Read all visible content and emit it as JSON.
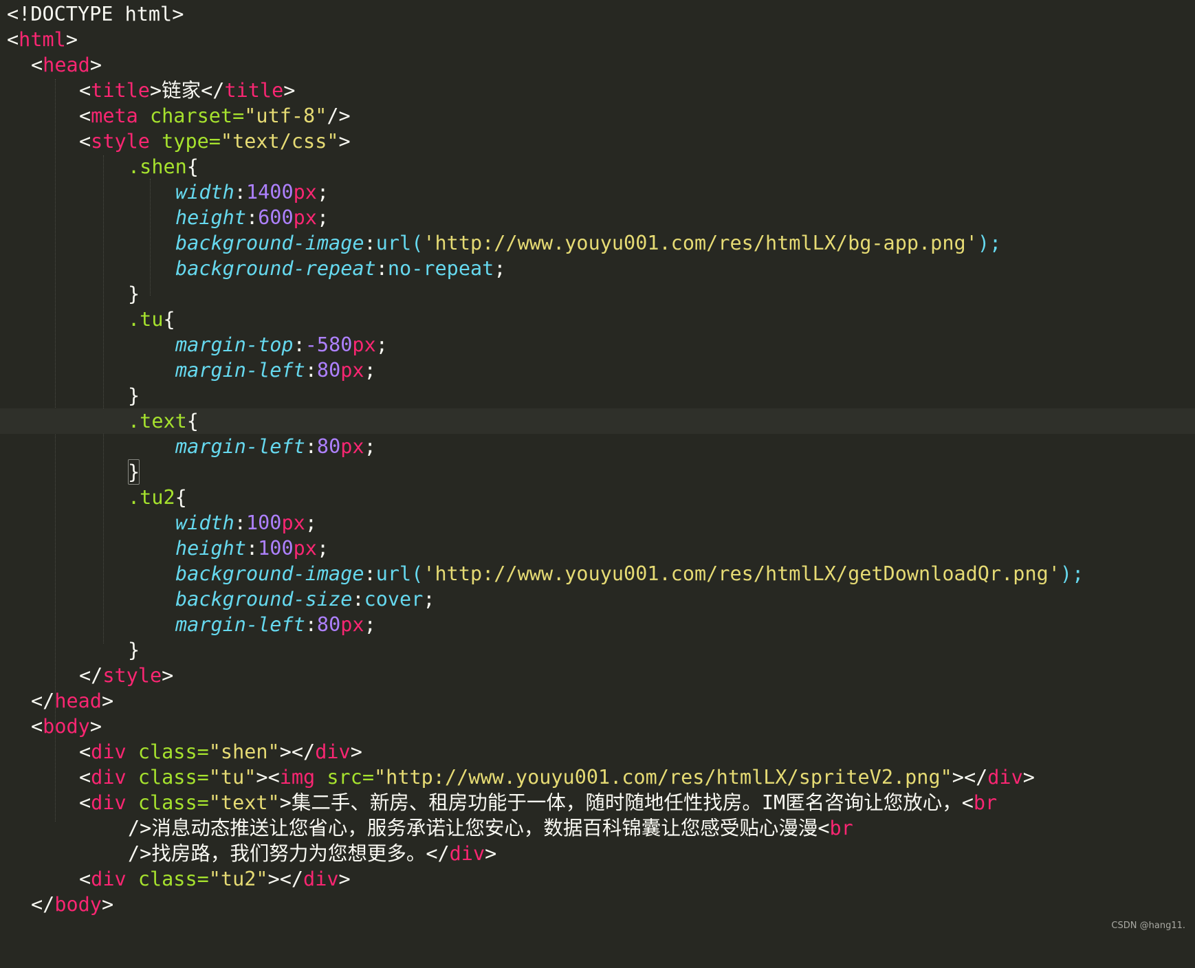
{
  "editor": {
    "theme": "monokai",
    "colors": {
      "background": "#272822",
      "tag": "#f92672",
      "attribute": "#a6e22e",
      "string": "#e6db74",
      "property": "#66d9ef",
      "number": "#ae81ff",
      "text": "#f8f8f2"
    },
    "lines": {
      "l1": "<!DOCTYPE html>",
      "l2_open": "<",
      "l2_tag": "html",
      "l2_close": ">",
      "l3_open": "<",
      "l3_tag": "head",
      "l3_close": ">",
      "l4_open": "<",
      "l4_tag": "title",
      "l4_mid": ">链家</",
      "l4_tag2": "title",
      "l4_close": ">",
      "l5_open": "<",
      "l5_tag": "meta",
      "l5_attr": " charset=",
      "l5_str": "\"utf-8\"",
      "l5_close": "/>",
      "l6_open": "<",
      "l6_tag": "style",
      "l6_attr": " type=",
      "l6_str": "\"text/css\"",
      "l6_close": ">",
      "l7_sel": ".shen",
      "l7_brace": "{",
      "l8_prop": "width",
      "l8_colon": ":",
      "l8_num": "1400",
      "l8_unit": "px",
      "l8_semi": ";",
      "l9_prop": "height",
      "l9_colon": ":",
      "l9_num": "600",
      "l9_unit": "px",
      "l9_semi": ";",
      "l10_prop": "background-image",
      "l10_colon": ":",
      "l10_fn": "url(",
      "l10_str": "'http://www.youyu001.com/res/htmlLX/bg-app.png'",
      "l10_end": ");",
      "l11_prop": "background-repeat",
      "l11_colon": ":",
      "l11_val": "no-repeat",
      "l11_semi": ";",
      "l12": "}",
      "l13_sel": ".tu",
      "l13_brace": "{",
      "l14_prop": "margin-top",
      "l14_colon": ":",
      "l14_num": "-580",
      "l14_unit": "px",
      "l14_semi": ";",
      "l15_prop": "margin-left",
      "l15_colon": ":",
      "l15_num": "80",
      "l15_unit": "px",
      "l15_semi": ";",
      "l16": "}",
      "l17_sel": ".text",
      "l17_brace": "{",
      "l18_prop": "margin-left",
      "l18_colon": ":",
      "l18_num": "80",
      "l18_unit": "px",
      "l18_semi": ";",
      "l19": "}",
      "l20_sel": ".tu2",
      "l20_brace": "{",
      "l21_prop": "width",
      "l21_colon": ":",
      "l21_num": "100",
      "l21_unit": "px",
      "l21_semi": ";",
      "l22_prop": "height",
      "l22_colon": ":",
      "l22_num": "100",
      "l22_unit": "px",
      "l22_semi": ";",
      "l23_prop": "background-image",
      "l23_colon": ":",
      "l23_fn": "url(",
      "l23_str": "'http://www.youyu001.com/res/htmlLX/getDownloadQr.png'",
      "l23_end": ");",
      "l24_prop": "background-size",
      "l24_colon": ":",
      "l24_val": "cover",
      "l24_semi": ";",
      "l25_prop": "margin-left",
      "l25_colon": ":",
      "l25_num": "80",
      "l25_unit": "px",
      "l25_semi": ";",
      "l26": "}",
      "l27_open": "</",
      "l27_tag": "style",
      "l27_close": ">",
      "l28_open": "</",
      "l28_tag": "head",
      "l28_close": ">",
      "l29_open": "<",
      "l29_tag": "body",
      "l29_close": ">",
      "l30_open": "<",
      "l30_tag": "div",
      "l30_attr": " class=",
      "l30_str": "\"shen\"",
      "l30_mid": "></",
      "l30_tag2": "div",
      "l30_close": ">",
      "l31_open": "<",
      "l31_tag": "div",
      "l31_attr": " class=",
      "l31_str": "\"tu\"",
      "l31_mid": "><",
      "l31_tag2": "img",
      "l31_attr2": " src=",
      "l31_str2": "\"http://www.youyu001.com/res/htmlLX/spriteV2.png\"",
      "l31_mid2": "></",
      "l31_tag3": "div",
      "l31_close": ">",
      "l32_open": "<",
      "l32_tag": "div",
      "l32_attr": " class=",
      "l32_str": "\"text\"",
      "l32_text": ">集二手、新房、租房功能于一体，随时随地任性找房。IM匿名咨询让您放心，<",
      "l32_tag2": "br",
      "l33_text": "/>消息动态推送让您省心，服务承诺让您安心，数据百科锦囊让您感受贴心漫漫<",
      "l33_tag": "br",
      "l34_text": "/>找房路，我们努力为您想更多。</",
      "l34_tag": "div",
      "l34_close": ">",
      "l35_open": "<",
      "l35_tag": "div",
      "l35_attr": " class=",
      "l35_str": "\"tu2\"",
      "l35_mid": "></",
      "l35_tag2": "div",
      "l35_close": ">",
      "l36_open": "</",
      "l36_tag": "body",
      "l36_close": ">"
    }
  },
  "watermark": "CSDN @hang11."
}
